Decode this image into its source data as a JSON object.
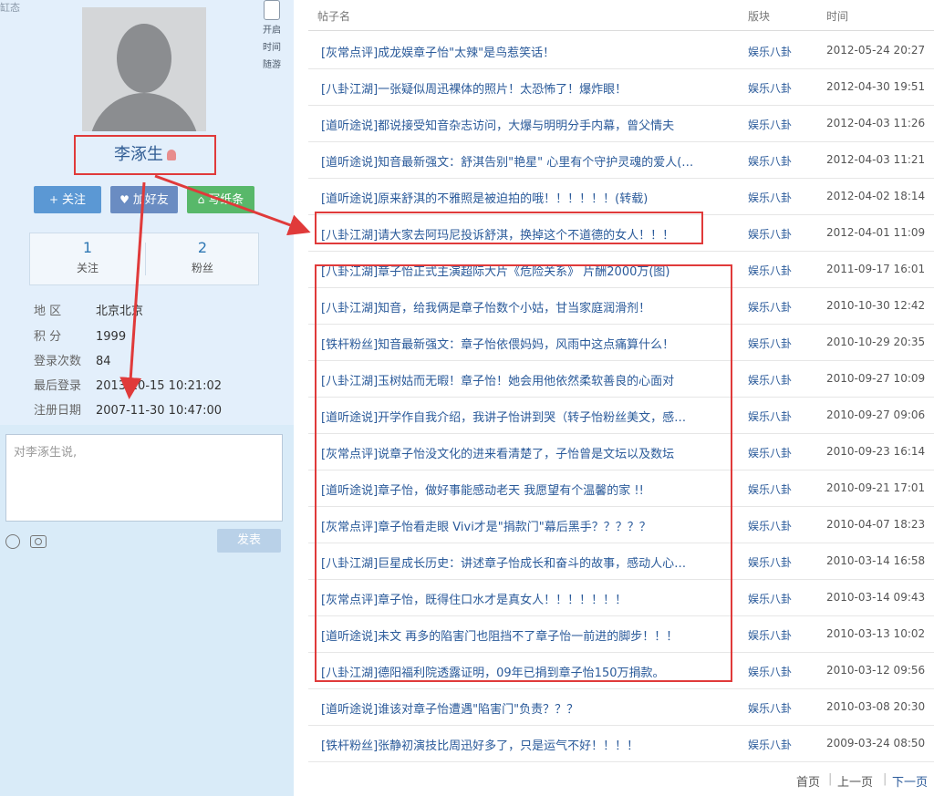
{
  "sidebar": {
    "corner_tab": "缸态",
    "side_tool": {
      "labels": [
        "开启",
        "时间",
        "随游"
      ]
    },
    "username": "李涿生",
    "buttons": {
      "follow": "关注",
      "friend": "加好友",
      "write": "写纸条"
    },
    "stats": [
      {
        "value": "1",
        "label": "关注"
      },
      {
        "value": "2",
        "label": "粉丝"
      }
    ],
    "info": [
      {
        "key": "地    区",
        "value": "北京北京"
      },
      {
        "key": "积    分",
        "value": "1999"
      },
      {
        "key": "登录次数",
        "value": "84"
      },
      {
        "key": "最后登录",
        "value": "2013-10-15 10:21:02"
      },
      {
        "key": "注册日期",
        "value": "2007-11-30 10:47:00"
      }
    ],
    "comment_placeholder": "对李涿生说,",
    "submit_label": "发表"
  },
  "list": {
    "headers": {
      "title": "帖子名",
      "board": "版块",
      "time": "时间"
    },
    "rows": [
      {
        "title": "[灰常点评]成龙娱章子怡\"太辣\"是鸟惹笑话！",
        "board": "娱乐八卦",
        "time": "2012-05-24 20:27"
      },
      {
        "title": "[八卦江湖]一张疑似周迅裸体的照片！太恐怖了！爆炸眼！",
        "board": "娱乐八卦",
        "time": "2012-04-30 19:51"
      },
      {
        "title": "[道听途说]都说接受知音杂志访问，大爆与明明分手内幕，曾父情夫",
        "board": "娱乐八卦",
        "time": "2012-04-03 11:26"
      },
      {
        "title": "[道听途说]知音最新强文：舒淇告别\"艳星\" 心里有个守护灵魂的爱人(…",
        "board": "娱乐八卦",
        "time": "2012-04-03 11:21"
      },
      {
        "title": "[道听途说]原来舒淇的不雅照是被迫拍的哦！！！！！！(转载)",
        "board": "娱乐八卦",
        "time": "2012-04-02 18:14"
      },
      {
        "title": "[八卦江湖]请大家去阿玛尼投诉舒淇，换掉这个不道德的女人！！！",
        "board": "娱乐八卦",
        "time": "2012-04-01 11:09"
      },
      {
        "title": "[八卦江湖]章子怡正式主演超际大片《危险关系》 片酬2000万(图)",
        "board": "娱乐八卦",
        "time": "2011-09-17 16:01"
      },
      {
        "title": "[八卦江湖]知音，给我俩是章子怡数个小姑，甘当家庭润滑剂！",
        "board": "娱乐八卦",
        "time": "2010-10-30 12:42"
      },
      {
        "title": "[铁杆粉丝]知音最新强文：章子怡依偎妈妈，风雨中这点痛算什么！",
        "board": "娱乐八卦",
        "time": "2010-10-29 20:35"
      },
      {
        "title": "[八卦江湖]玉树姑而无暇！章子怡！她会用他依然柔软善良的心面对",
        "board": "娱乐八卦",
        "time": "2010-09-27 10:09"
      },
      {
        "title": "[道听途说]开学作自我介绍，我讲子怡讲到哭（转子怡粉丝美文，感…",
        "board": "娱乐八卦",
        "time": "2010-09-27 09:06"
      },
      {
        "title": "[灰常点评]说章子怡没文化的进来看清楚了，子怡曾是文坛以及数坛",
        "board": "娱乐八卦",
        "time": "2010-09-23 16:14"
      },
      {
        "title": "[道听途说]章子怡，做好事能感动老天 我愿望有个温馨的家 !!",
        "board": "娱乐八卦",
        "time": "2010-09-21 17:01"
      },
      {
        "title": "[灰常点评]章子怡看走眼 Vivi才是\"捐款门\"幕后黑手？？？？？",
        "board": "娱乐八卦",
        "time": "2010-04-07 18:23"
      },
      {
        "title": "[八卦江湖]巨星成长历史：讲述章子怡成长和奋斗的故事，感动人心…",
        "board": "娱乐八卦",
        "time": "2010-03-14 16:58"
      },
      {
        "title": "[灰常点评]章子怡，既得住口水才是真女人！！！！！！！",
        "board": "娱乐八卦",
        "time": "2010-03-14 09:43"
      },
      {
        "title": "[道听途说]未文 再多的陷害门也阻挡不了章子怡一前进的脚步！！！",
        "board": "娱乐八卦",
        "time": "2010-03-13 10:02"
      },
      {
        "title": "[八卦江湖]德阳福利院透露证明，09年已捐到章子怡150万捐款。",
        "board": "娱乐八卦",
        "time": "2010-03-12 09:56"
      },
      {
        "title": "[道听途说]谁该对章子怡遭遇\"陷害门\"负责？？？",
        "board": "娱乐八卦",
        "time": "2010-03-08 20:30"
      },
      {
        "title": "[铁杆粉丝]张静初演技比周迅好多了，只是运气不好！！！！",
        "board": "娱乐八卦",
        "time": "2009-03-24 08:50"
      }
    ],
    "pager": {
      "first": "首页",
      "prev": "上一页",
      "next": "下一页"
    }
  },
  "colors": {
    "link": "#2a5a9a",
    "annotation": "#e03a3a",
    "sidebar_bg": "#d9ebf8"
  }
}
